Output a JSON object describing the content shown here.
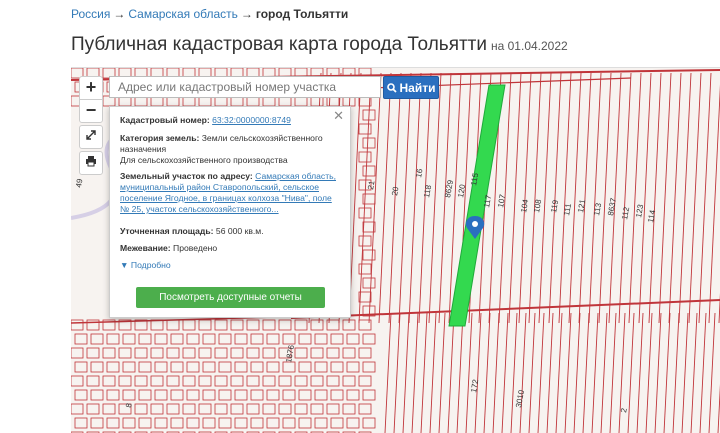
{
  "breadcrumb": {
    "items": [
      "Россия",
      "Самарская область"
    ],
    "current": "город Тольятти",
    "separator": "→"
  },
  "page": {
    "title": "Публичная кадастровая карта города Тольятти",
    "date": "на 01.04.2022"
  },
  "map": {
    "zoom_in": "+",
    "zoom_out": "−",
    "search_placeholder": "Адрес или кадастровый номер участка",
    "find_label": "Найти",
    "labels": [
      "49",
      "21",
      "20",
      "16",
      "118",
      "8629",
      "120",
      "115",
      "117",
      "107",
      "104",
      "108",
      "119",
      "111",
      "121",
      "113",
      "8637",
      "112",
      "123",
      "114",
      "1876",
      "3010",
      "172",
      "8",
      "2"
    ],
    "colors": {
      "lines": "#c0353a",
      "highlight": "#33d94f",
      "button": "#2a6fbf"
    }
  },
  "popup": {
    "close": "✕",
    "cad_label": "Кадастровый номер:",
    "cad_value": "63:32:0000000:8749",
    "cat_label": "Категория земель:",
    "cat_value": "Земли сельскохозяйственного назначения",
    "cat_use": "Для сельскохозяйственного производства",
    "addr_label": "Земельный участок по адресу:",
    "addr_value": "Самарская область, муниципальный район Ставропольский, сельское поселение Ягодное, в границах колхоза \"Нива\", поле № 25, участок сельскохозяйственного...",
    "area_label": "Уточненная площадь:",
    "area_value": "56 000 кв.м.",
    "bound_label": "Межевание:",
    "bound_value": "Проведено",
    "more": "Подробно",
    "reports_button": "Посмотреть доступные отчеты"
  }
}
